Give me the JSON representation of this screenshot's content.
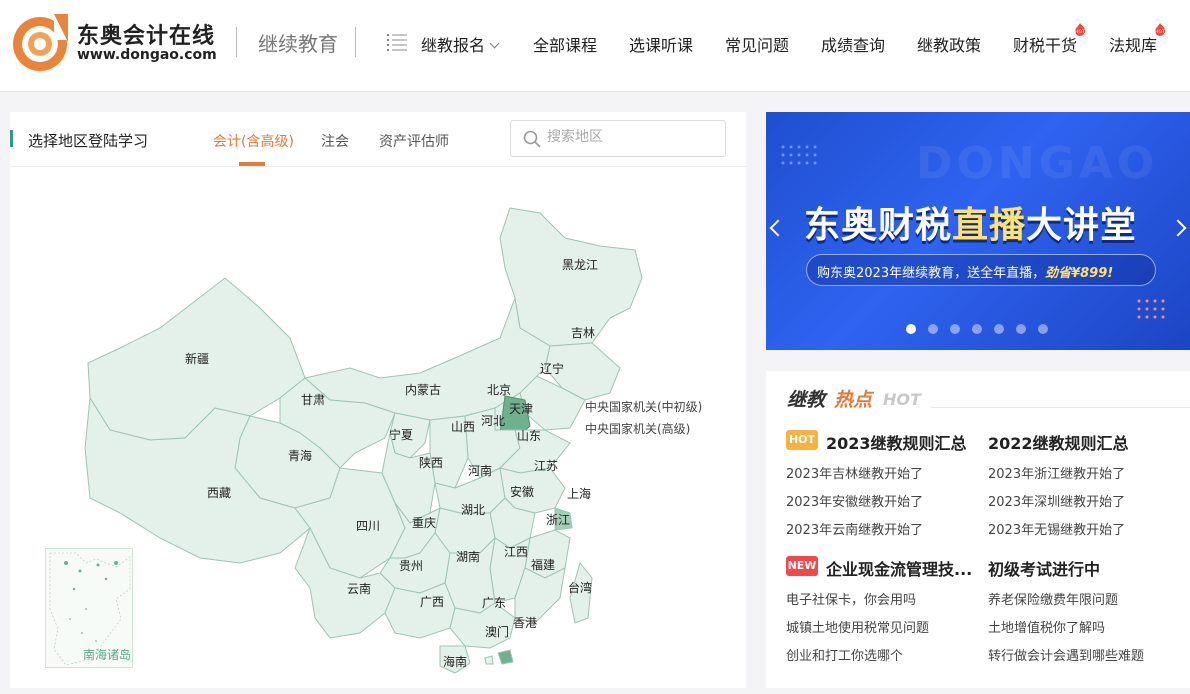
{
  "header": {
    "logo_title": "东奥会计在线",
    "logo_url_text": "www.dongao.com",
    "subtitle": "继续教育",
    "nav": [
      {
        "label": "继教报名"
      },
      {
        "label": "全部课程"
      },
      {
        "label": "选课听课"
      },
      {
        "label": "常见问题"
      },
      {
        "label": "成绩查询"
      },
      {
        "label": "继教政策"
      },
      {
        "label": "财税干货"
      },
      {
        "label": "法规库"
      }
    ],
    "hot_badge_text": "HOT"
  },
  "region_panel": {
    "title": "选择地区登陆学习",
    "tabs": [
      "会计(含高级)",
      "注会",
      "资产评估师"
    ],
    "active_tab": 0,
    "search_placeholder": "搜索地区",
    "provinces": [
      "黑龙江",
      "吉林",
      "辽宁",
      "新疆",
      "内蒙古",
      "北京",
      "天津",
      "甘肃",
      "河北",
      "宁夏",
      "山西",
      "山东",
      "青海",
      "陕西",
      "河南",
      "江苏",
      "西藏",
      "安徽",
      "上海",
      "湖北",
      "四川",
      "重庆",
      "浙江",
      "江西",
      "湖南",
      "福建",
      "贵州",
      "云南",
      "广西",
      "广东",
      "台湾",
      "香港",
      "澳门",
      "海南"
    ],
    "central_links": [
      "中央国家机关(中初级)",
      "中央国家机关(高级)"
    ],
    "inset_label": "南海诸岛"
  },
  "banner": {
    "title_part1": "东奥财税",
    "title_part2": "直播",
    "title_part3": "大讲堂",
    "subtitle": "购东奥2023年继续教育，送全年直播，",
    "subtitle_highlight": "劲省¥899!",
    "watermark": "DONGAO",
    "dot_count": 7,
    "active_dot": 0
  },
  "hot_news": {
    "logo_part1": "继教",
    "logo_part2": "热点",
    "logo_part3": "HOT",
    "sections": [
      {
        "badge": "HOT",
        "left_heading": "2023继教规则汇总",
        "right_heading": "2022继教规则汇总",
        "left_links": [
          "2023年吉林继教开始了",
          "2023年安徽继教开始了",
          "2023年云南继教开始了"
        ],
        "right_links": [
          "2023年浙江继教开始了",
          "2023年深圳继教开始了",
          "2023年无锡继教开始了"
        ]
      },
      {
        "badge": "NEW",
        "left_heading": "企业现金流管理技...",
        "right_heading": "初级考试进行中",
        "left_links": [
          "电子社保卡，你会用吗",
          "城镇土地使用税常见问题",
          "创业和打工你选哪个"
        ],
        "right_links": [
          "养老保险缴费年限问题",
          "土地增值税你了解吗",
          "转行做会计会遇到哪些难题"
        ]
      }
    ]
  },
  "colors": {
    "accent": "#e07b39",
    "map_fill": "#e4f1ea",
    "map_stroke": "#9fc3b1",
    "map_highlight": "#6fb08f",
    "banner_blue": "#2f63f0"
  }
}
